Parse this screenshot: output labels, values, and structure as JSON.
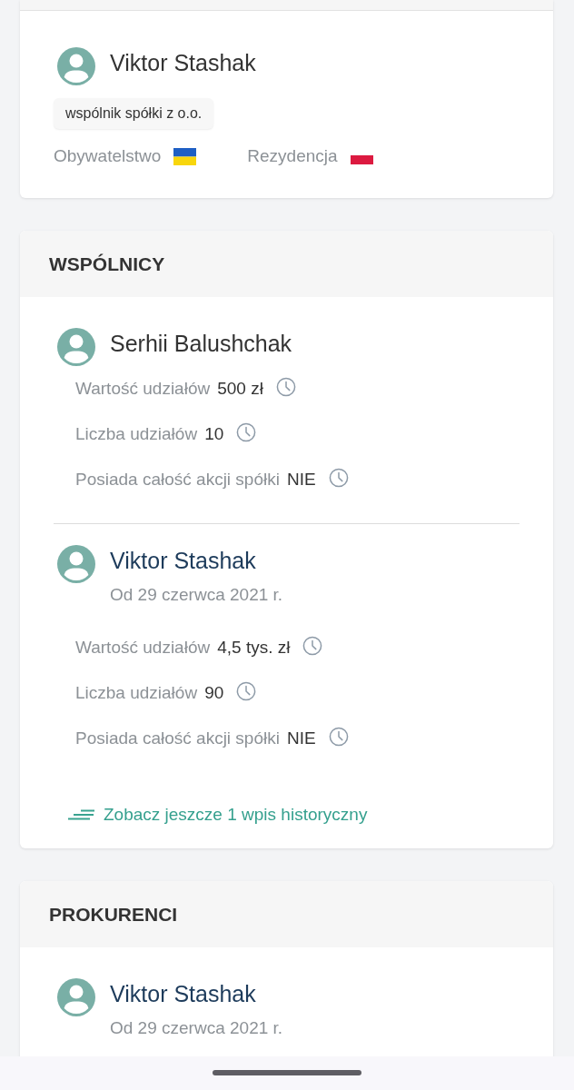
{
  "owner": {
    "name": "Viktor Stashak",
    "link": false,
    "role_badge": "wspólnik spółki z o.o.",
    "attributes": [
      {
        "label": "Obywatelstwo",
        "kind": "ua"
      },
      {
        "label": "Rezydencja",
        "kind": "pl"
      }
    ]
  },
  "sections": [
    {
      "title": "WSPÓLNICY",
      "entries": [
        {
          "name": "Serhii Balushchak",
          "link": false,
          "details": [
            {
              "label": "Wartość udziałów",
              "value": "500 zł"
            },
            {
              "label": "Liczba udziałów",
              "value": "10"
            },
            {
              "label": "Posiada całość akcji spółki",
              "value": "NIE"
            }
          ]
        },
        {
          "name": "Viktor Stashak",
          "link": true,
          "since": "Od 29 czerwca 2021 r.",
          "details": [
            {
              "label": "Wartość udziałów",
              "value": "4,5 tys. zł"
            },
            {
              "label": "Liczba udziałów",
              "value": "90"
            },
            {
              "label": "Posiada całość akcji spółki",
              "value": "NIE"
            }
          ]
        }
      ],
      "history_link": "Zobacz jeszcze 1 wpis historyczny"
    },
    {
      "title": "PROKURENCI",
      "entries": [
        {
          "name": "Viktor Stashak",
          "link": true,
          "since": "Od 29 czerwca 2021 r."
        }
      ]
    }
  ]
}
